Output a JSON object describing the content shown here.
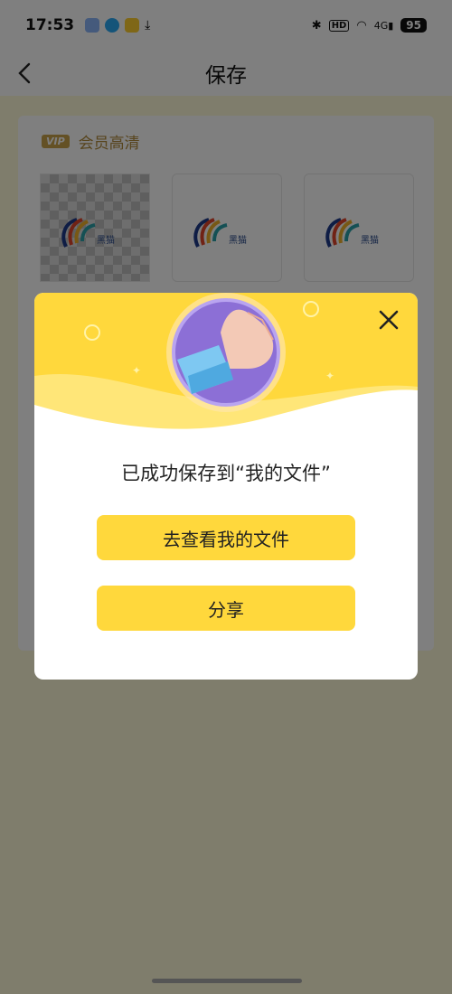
{
  "status_bar": {
    "time": "17:53",
    "hd": "HD",
    "network": "4G",
    "battery": "95"
  },
  "navbar": {
    "title": "保存",
    "back_icon": "chevron-left-icon"
  },
  "card": {
    "vip_badge": "VIP",
    "vip_label": "会员高清",
    "thumbnails": [
      {
        "logo_text": "黑猫",
        "transparent": true
      },
      {
        "logo_text": "黑猫",
        "transparent": false
      },
      {
        "logo_text": "黑猫",
        "transparent": false
      }
    ]
  },
  "dialog": {
    "message": "已成功保存到“我的文件”",
    "view_files_label": "去查看我的文件",
    "share_label": "分享",
    "close_icon": "close-icon"
  },
  "colors": {
    "accent": "#ffd83c",
    "vip_gold": "#b08a3c",
    "overlay": "rgba(0,0,0,0.5)"
  }
}
